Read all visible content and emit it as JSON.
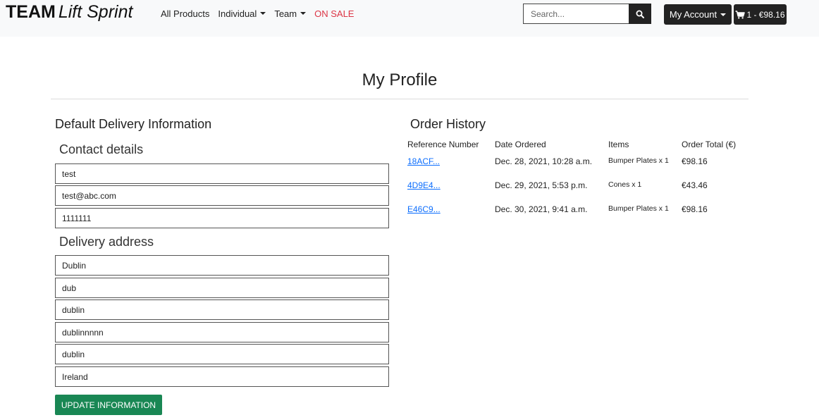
{
  "brand": {
    "part1": "TEAM",
    "part2": "Lift Sprint"
  },
  "nav": {
    "all_products": "All Products",
    "individual": "Individual",
    "team": "Team",
    "on_sale": "ON SALE"
  },
  "search": {
    "placeholder": "Search..."
  },
  "account": {
    "label": "My Account"
  },
  "bag": {
    "label": "1 - €98.16"
  },
  "page_title": "My Profile",
  "delivery": {
    "title": "Default Delivery Information",
    "contact_title": "Contact details",
    "contact_fields": [
      "test",
      "test@abc.com",
      "1111111"
    ],
    "address_title": "Delivery address",
    "address_fields": [
      "Dublin",
      "dub",
      "dublin",
      "dublinnnnn",
      "dublin",
      "Ireland"
    ],
    "update_label": "UPDATE INFORMATION"
  },
  "orders": {
    "title": "Order History",
    "headers": [
      "Reference Number",
      "Date Ordered",
      "Items",
      "Order Total (€)"
    ],
    "rows": [
      {
        "ref": "18ACF...",
        "date": "Dec. 28, 2021, 10:28 a.m.",
        "items": "Bumper Plates x 1",
        "total": "€98.16"
      },
      {
        "ref": "4D9E4...",
        "date": "Dec. 29, 2021, 5:53 p.m.",
        "items": "Cones x 1",
        "total": "€43.46"
      },
      {
        "ref": "E46C9...",
        "date": "Dec. 30, 2021, 9:41 a.m.",
        "items": "Bumper Plates x 1",
        "total": "€98.16"
      }
    ]
  },
  "colors": {
    "sale": "#dc3545",
    "update_button": "#198754",
    "link": "#0d6efd",
    "dark_button": "#222222"
  },
  "icons": {
    "search": "search-icon",
    "bag": "shopping-cart-icon"
  }
}
